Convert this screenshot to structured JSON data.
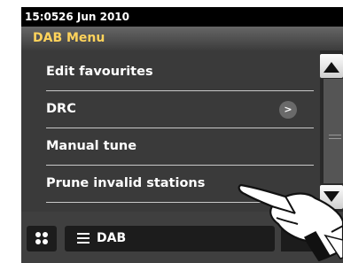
{
  "status": {
    "time": "15:05",
    "date": "26 Jun 2010"
  },
  "menu": {
    "title": "DAB Menu",
    "items": [
      {
        "label": "Edit favourites"
      },
      {
        "label": "DRC",
        "has_submenu": true,
        "chevron": ">"
      },
      {
        "label": "Manual tune"
      },
      {
        "label": "Prune invalid stations"
      }
    ]
  },
  "scrollbar": {
    "up_icon": "triangle-up-icon",
    "down_icon": "triangle-down-icon",
    "thumb_icon": "scroll-thumb-icon"
  },
  "bottom_bar": {
    "home_icon": "grid-icon",
    "source_label": "DAB",
    "source_icon": "list-icon"
  },
  "overlay": {
    "icon": "pointing-hand-icon"
  },
  "colors": {
    "title_text": "#ffd35b",
    "screen_bg": "#000000",
    "panel_bg": "#3a3a3a"
  }
}
